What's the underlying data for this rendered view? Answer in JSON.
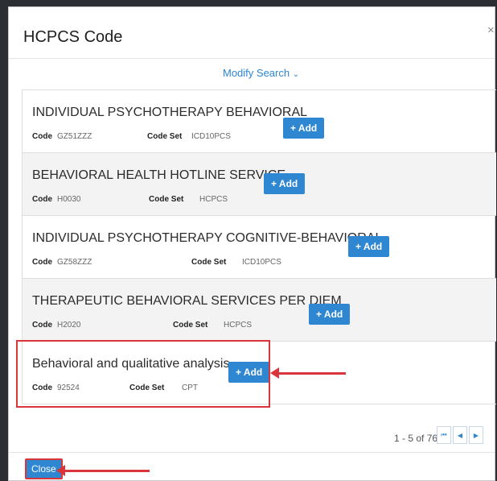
{
  "modal": {
    "title": "HCPCS Code",
    "close_glyph": "×",
    "modify_search": "Modify Search",
    "modify_search_icon": "chevron-down-icon"
  },
  "labels": {
    "code": "Code",
    "code_set": "Code Set",
    "add": "+ Add"
  },
  "results": [
    {
      "title": "INDIVIDUAL PSYCHOTHERAPY BEHAVIORAL",
      "code": "GZ51ZZZ",
      "code_set": "ICD10PCS"
    },
    {
      "title": "BEHAVIORAL HEALTH HOTLINE SERVICE",
      "code": "H0030",
      "code_set": "HCPCS"
    },
    {
      "title": "INDIVIDUAL PSYCHOTHERAPY COGNITIVE-BEHAVIORAL",
      "code": "GZ58ZZZ",
      "code_set": "ICD10PCS"
    },
    {
      "title": "THERAPEUTIC BEHAVIORAL SERVICES PER DIEM",
      "code": "H2020",
      "code_set": "HCPCS"
    },
    {
      "title": "Behavioral and qualitative analysis",
      "code": "92524",
      "code_set": "CPT"
    }
  ],
  "pagination": {
    "summary": "1 - 5 of 76",
    "first_glyph": "⏮",
    "prev_glyph": "◀",
    "next_glyph": "▶"
  },
  "footer": {
    "close_label": "Close"
  },
  "colors": {
    "accent": "#2f86d1",
    "annotation": "#d9353b",
    "row_alt": "#f3f3f3"
  }
}
